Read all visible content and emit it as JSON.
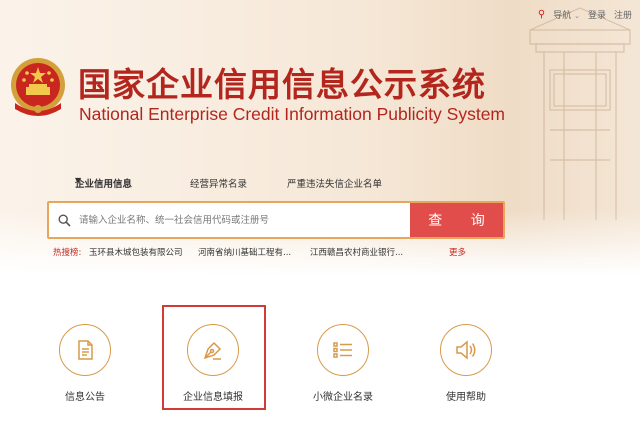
{
  "topbar": {
    "nav_label": "导航",
    "login_label": "登录",
    "register_label": "注册"
  },
  "header": {
    "title_cn": "国家企业信用信息公示系统",
    "title_en": "National Enterprise Credit Information Publicity System"
  },
  "tabs": [
    {
      "label": "企业信用信息",
      "active": true
    },
    {
      "label": "经营异常名录",
      "active": false
    },
    {
      "label": "严重违法失信企业名单",
      "active": false
    }
  ],
  "search": {
    "placeholder": "请输入企业名称、统一社会信用代码或注册号",
    "value": "",
    "button_label": "查 询"
  },
  "hot_search": {
    "label": "热搜榜:",
    "items": [
      "玉环县木城包装有限公司",
      "河南省纳川基础工程有...",
      "江西赣昌农村商业银行..."
    ],
    "more_label": "更多"
  },
  "features": [
    {
      "label": "信息公告",
      "icon": "document-icon"
    },
    {
      "label": "企业信息填报",
      "icon": "pen-nib-icon",
      "highlighted": true
    },
    {
      "label": "小微企业名录",
      "icon": "list-icon"
    },
    {
      "label": "使用帮助",
      "icon": "speaker-icon"
    }
  ],
  "colors": {
    "brand_red": "#b3261e",
    "search_button": "#e04d4a",
    "accent_gold": "#d89a4a",
    "highlight_box": "#d23a35"
  }
}
